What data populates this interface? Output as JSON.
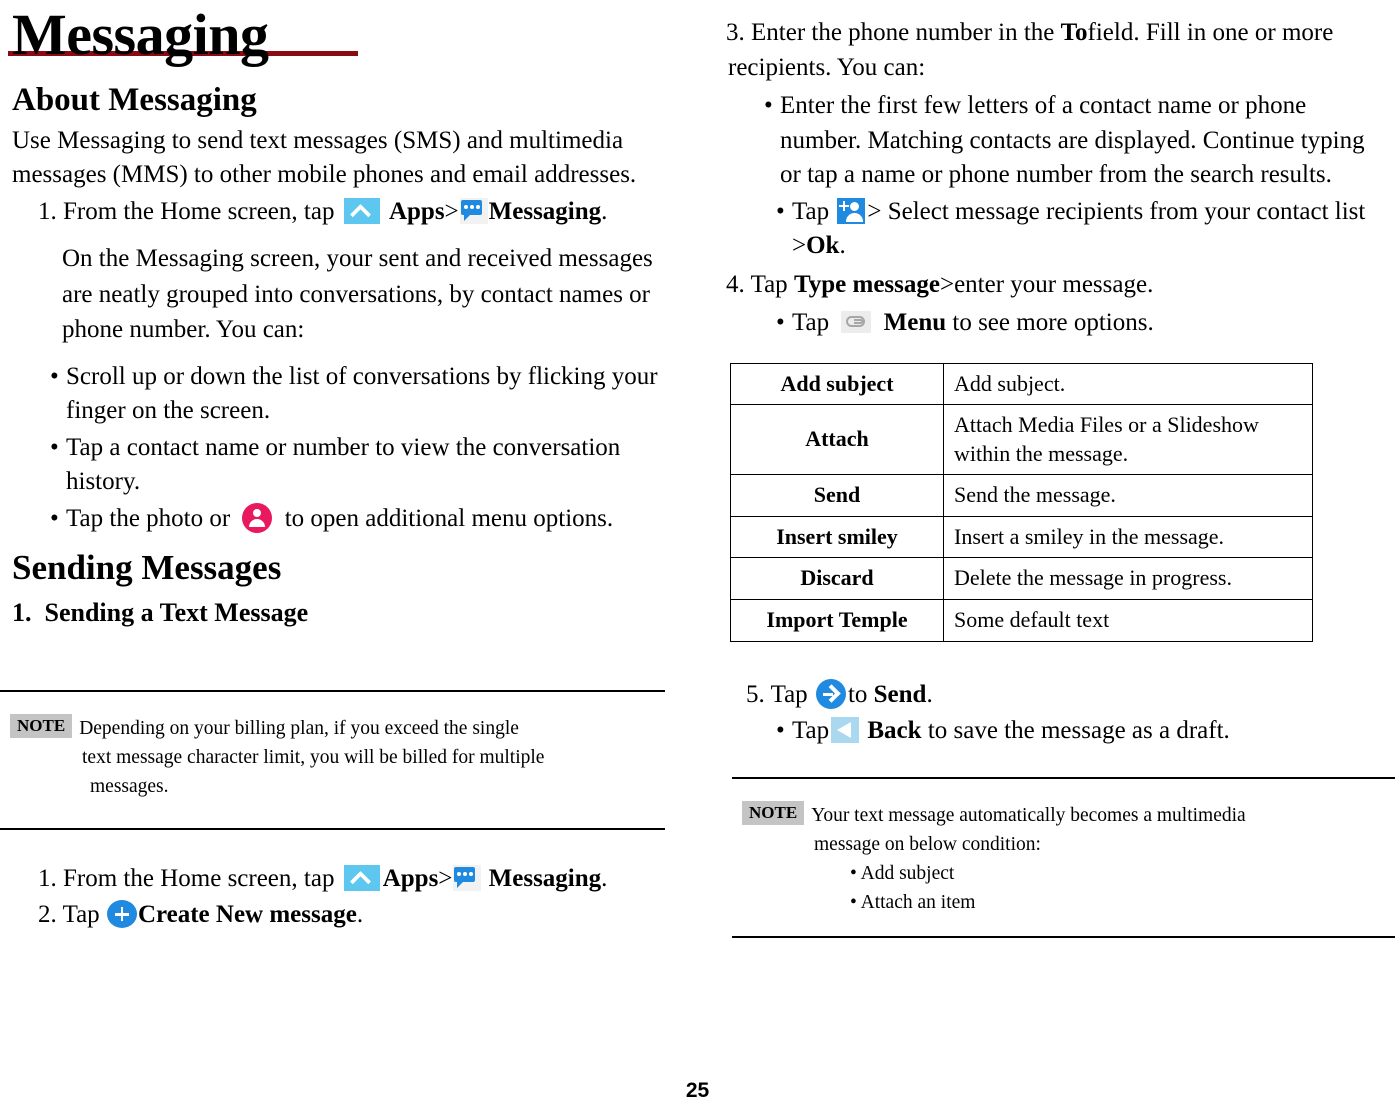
{
  "document": {
    "title": "Messaging",
    "page_number": "25",
    "accent_rule_color": "#8b0b13"
  },
  "left_column": {
    "about": {
      "heading": "About Messaging",
      "intro": "Use Messaging to send text messages (SMS) and multimedia messages (MMS) to other mobile phones and email addresses.",
      "step1": {
        "number": "1.",
        "text_before": "From the Home screen, tap",
        "apps_label": "Apps",
        "separator": ">",
        "messaging_label": "Messaging",
        "period": "."
      },
      "paragraph": "On the Messaging screen, your sent and received messages are neatly grouped into conversations, by contact names or phone number. You can:",
      "bullets": [
        {
          "dot": "•",
          "text": "Scroll up or down the list of conversations by flicking your finger on the screen."
        },
        {
          "dot": "•",
          "text": "Tap a contact name or number to view the conversation history."
        }
      ],
      "bullet_photo": {
        "dot": "•",
        "text_before": "Tap the photo or",
        "text_after": "to open additional menu options."
      }
    },
    "sending": {
      "heading": "Sending Messages",
      "subheading_number": "1.",
      "subheading": "Sending a Text Message",
      "note": {
        "label": "NOTE",
        "line1": "Depending on your billing plan, if you exceed the single",
        "line2": "text message character limit, you will be billed for multiple",
        "line3": "messages."
      },
      "step1": {
        "number": "1.",
        "text_before": "From the Home screen, tap",
        "apps_label": "Apps",
        "separator": ">",
        "messaging_label": "Messaging",
        "period": "."
      },
      "step2": {
        "number": "2.",
        "text_before": "Tap",
        "label": "Create New message",
        "period": "."
      }
    }
  },
  "right_column": {
    "step3": {
      "number": "3.",
      "text_a": "Enter the phone number in the",
      "bold_to": "To",
      "text_b": "field. Fill in one or more recipients. You can:",
      "bullets": [
        {
          "dot": "•",
          "text": "Enter the first few letters of a contact name or phone number. Matching contacts are displayed. Continue typing or tap a name or phone number from the search results."
        }
      ],
      "bullet_select": {
        "dot": "•",
        "text_before": "Tap",
        "text_after": "> Select message recipients from your contact list >",
        "bold_ok": "Ok",
        "period": "."
      }
    },
    "step4": {
      "number": "4.",
      "text_before": "Tap",
      "bold_label": "Type message",
      "text_after": ">enter your message.",
      "bullet": {
        "dot": "•",
        "text_before": "Tap",
        "bold_menu": "Menu",
        "text_after": "to see more options."
      }
    },
    "options_table": {
      "rows": [
        {
          "option": "Add subject",
          "description": "Add subject."
        },
        {
          "option": "Attach",
          "description": "Attach Media Files or a Slideshow within the message."
        },
        {
          "option": "Send",
          "description": "Send the message."
        },
        {
          "option": "Insert smiley",
          "description": "Insert a smiley in the message."
        },
        {
          "option": "Discard",
          "description": "Delete the message in progress."
        },
        {
          "option": "Import Temple",
          "description": "Some default text"
        }
      ]
    },
    "step5": {
      "number": "5.",
      "text_before": "Tap",
      "text_mid": "to",
      "bold_send": "Send",
      "period": ".",
      "bullet": {
        "dot": "•",
        "text_before": "Tap",
        "bold_back": "Back",
        "text_after": "to save the message as a draft."
      }
    },
    "note": {
      "label": "NOTE",
      "line1": "Your text message automatically becomes a multimedia",
      "line2": "message on below condition:",
      "bullets": [
        {
          "dot": "•",
          "text": "Add subject"
        },
        {
          "dot": "•",
          "text": "Attach an item"
        }
      ]
    }
  },
  "icons": {
    "apps": "chevron-up-icon",
    "messaging": "message-bubble-icon",
    "contact": "person-circle-icon",
    "add_contact": "add-person-icon",
    "menu": "menu-icon",
    "send": "send-icon",
    "back": "back-arrow-icon",
    "create": "plus-circle-icon"
  }
}
